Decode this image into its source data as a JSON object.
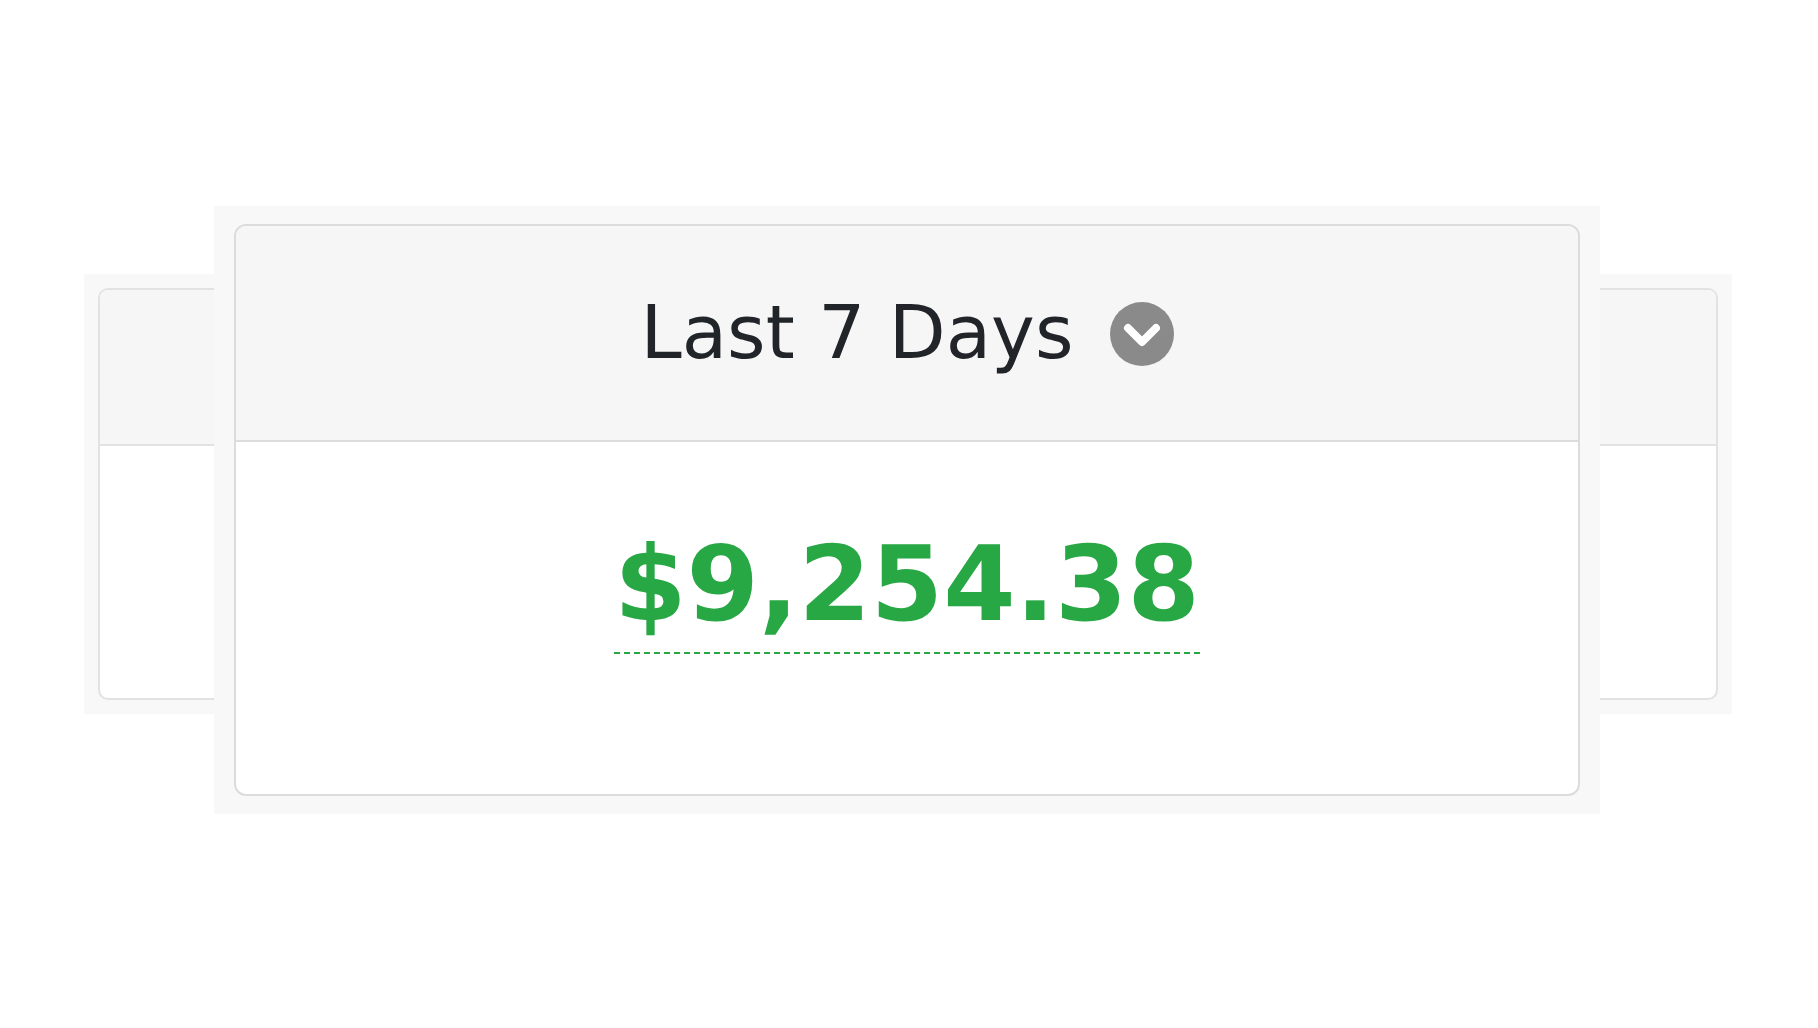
{
  "card": {
    "title": "Last 7 Days",
    "amount": "$9,254.38"
  }
}
